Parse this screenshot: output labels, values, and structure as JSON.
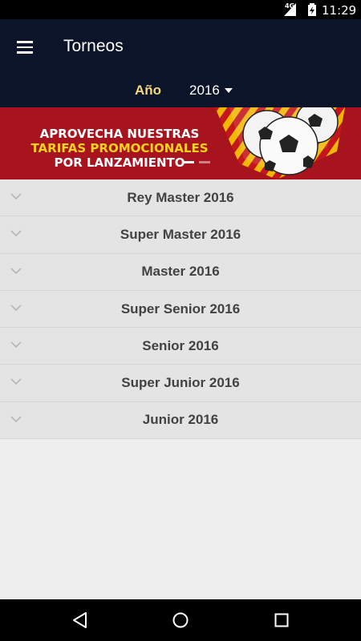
{
  "status_bar": {
    "network": "4G",
    "time": "11:29",
    "icons": [
      "signal-icon",
      "battery-charging-icon"
    ]
  },
  "app_bar": {
    "title": "Torneos",
    "menu_icon": "hamburger-menu-icon"
  },
  "filter": {
    "year_label": "Año",
    "year_value": "2016"
  },
  "banner": {
    "line1": "APROVECHA NUESTRAS",
    "line2": "TARIFAS PROMOCIONALES",
    "line3": "POR LANZAMIENTO",
    "slides": 2,
    "active_slide": 1,
    "colors": {
      "background": "#a8141e",
      "highlight": "#ffd21c"
    }
  },
  "tournaments": [
    {
      "label": "Rey Master 2016"
    },
    {
      "label": "Super Master 2016"
    },
    {
      "label": "Master 2016"
    },
    {
      "label": "Super Senior 2016"
    },
    {
      "label": "Senior 2016"
    },
    {
      "label": "Super Junior 2016"
    },
    {
      "label": "Junior 2016"
    }
  ],
  "nav": {
    "buttons": [
      "back-icon",
      "home-icon",
      "recent-apps-icon"
    ]
  },
  "colors": {
    "app_bar": "#0b1428",
    "year_label": "#f6d77a",
    "list_background": "#e4e4e4",
    "page_background": "#eeeeee"
  }
}
